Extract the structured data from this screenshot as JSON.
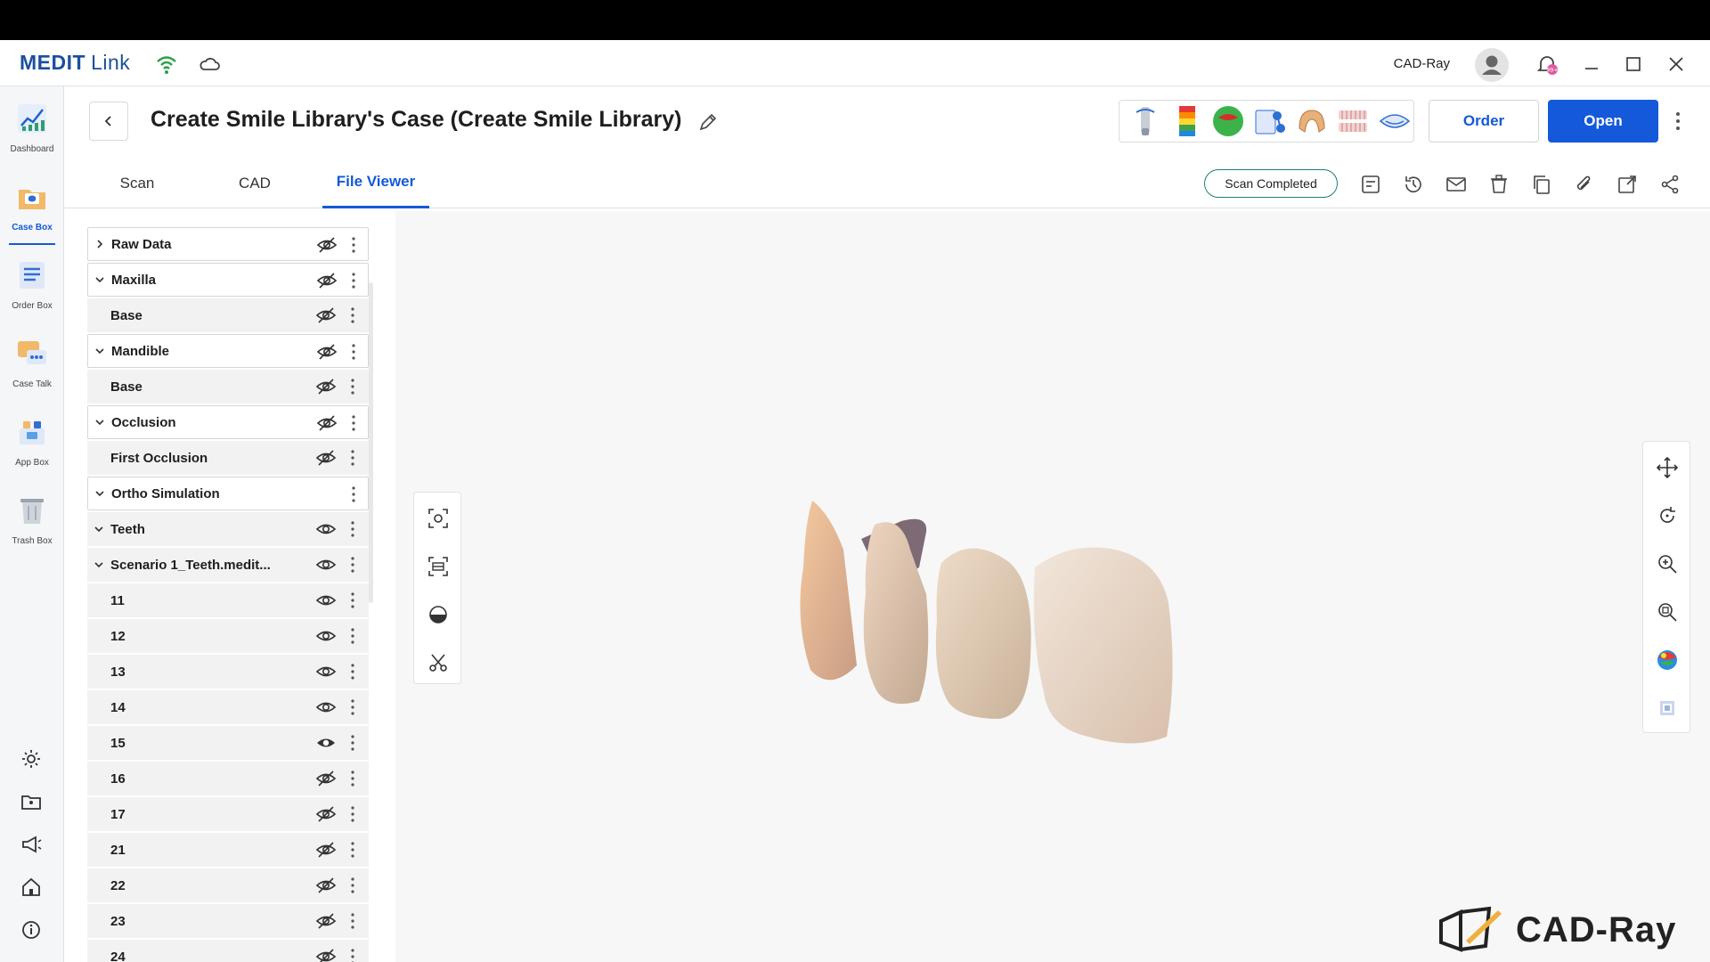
{
  "app": {
    "brand": "MEDIT",
    "brand_sub": "Link",
    "user_name": "CAD-Ray",
    "notification_count": "99+"
  },
  "sidebar": {
    "items": [
      {
        "label": "Dashboard",
        "icon": "dashboard-icon"
      },
      {
        "label": "Case Box",
        "icon": "case-box-icon",
        "active": true
      },
      {
        "label": "Order Box",
        "icon": "order-box-icon"
      },
      {
        "label": "Case Talk",
        "icon": "case-talk-icon"
      },
      {
        "label": "App Box",
        "icon": "app-box-icon"
      },
      {
        "label": "Trash Box",
        "icon": "trash-box-icon"
      }
    ],
    "bottom_icons": [
      "settings-icon",
      "folder-user-icon",
      "announcement-icon",
      "home-icon",
      "info-icon"
    ]
  },
  "header": {
    "case_title": "Create Smile Library's Case (Create Smile Library)",
    "order_label": "Order",
    "open_label": "Open"
  },
  "tabs": [
    {
      "label": "Scan"
    },
    {
      "label": "CAD"
    },
    {
      "label": "File Viewer",
      "active": true
    }
  ],
  "status": {
    "badge": "Scan Completed"
  },
  "tree": {
    "rows": [
      {
        "name": "Raw Data",
        "kind": "group",
        "chevron": "right",
        "eye": "hidden"
      },
      {
        "name": "Maxilla",
        "kind": "group",
        "chevron": "down",
        "eye": "hidden"
      },
      {
        "name": "Base",
        "kind": "plain",
        "eye": "hidden"
      },
      {
        "name": "Mandible",
        "kind": "group",
        "chevron": "down",
        "eye": "hidden"
      },
      {
        "name": "Base",
        "kind": "plain",
        "eye": "hidden"
      },
      {
        "name": "Occlusion",
        "kind": "group",
        "chevron": "down",
        "eye": "hidden"
      },
      {
        "name": "First Occlusion",
        "kind": "plain",
        "eye": "hidden"
      },
      {
        "name": "Ortho Simulation",
        "kind": "group",
        "chevron": "down",
        "eye": "none"
      },
      {
        "name": "Teeth",
        "kind": "plain",
        "chevron": "down",
        "eye": "visible"
      },
      {
        "name": "Scenario 1_Teeth.medit...",
        "kind": "plain",
        "chevron": "down",
        "eye": "visible"
      },
      {
        "name": "11",
        "kind": "plain",
        "eye": "visible"
      },
      {
        "name": "12",
        "kind": "plain",
        "eye": "visible"
      },
      {
        "name": "13",
        "kind": "plain",
        "eye": "visible"
      },
      {
        "name": "14",
        "kind": "plain",
        "eye": "visible"
      },
      {
        "name": "15",
        "kind": "plain",
        "eye": "hover"
      },
      {
        "name": "16",
        "kind": "plain",
        "eye": "hidden"
      },
      {
        "name": "17",
        "kind": "plain",
        "eye": "hidden"
      },
      {
        "name": "21",
        "kind": "plain",
        "eye": "hidden"
      },
      {
        "name": "22",
        "kind": "plain",
        "eye": "hidden"
      },
      {
        "name": "23",
        "kind": "plain",
        "eye": "hidden"
      },
      {
        "name": "24",
        "kind": "plain",
        "eye": "hidden"
      }
    ]
  },
  "watermark": {
    "text": "CAD-Ray"
  }
}
